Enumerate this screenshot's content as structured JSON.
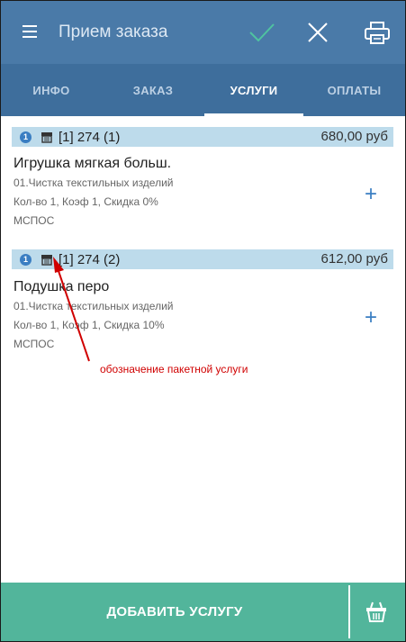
{
  "appbar": {
    "title": "Прием заказа",
    "icons": [
      "menu-icon",
      "check-icon",
      "close-icon",
      "print-icon"
    ],
    "check_color": "#4fc4a0"
  },
  "tabs": [
    {
      "label": "ИНФО",
      "active": false
    },
    {
      "label": "ЗАКАЗ",
      "active": false
    },
    {
      "label": "УСЛУГИ",
      "active": true
    },
    {
      "label": "ОПЛАТЫ",
      "active": false
    }
  ],
  "services": [
    {
      "index": "1",
      "code": "[1] 274 (1)",
      "price": "680,00 руб",
      "name": "Игрушка мягкая больш.",
      "category": "01.Чистка текстильных изделий",
      "details": "Кол-во 1, Коэф 1, Скидка 0%",
      "method": "МСПОС"
    },
    {
      "index": "1",
      "code": "[1] 274 (2)",
      "price": "612,00 руб",
      "name": "Подушка перо",
      "category": "01.Чистка текстильных изделий",
      "details": "Кол-во 1, Коэф 1, Скидка 10%",
      "method": "МСПОС"
    }
  ],
  "annotation": {
    "text": "обозначение пакетной услуги",
    "color": "#d00000"
  },
  "bottom": {
    "add_label": "ДОБАВИТЬ УСЛУГУ",
    "color": "#52b59b"
  }
}
